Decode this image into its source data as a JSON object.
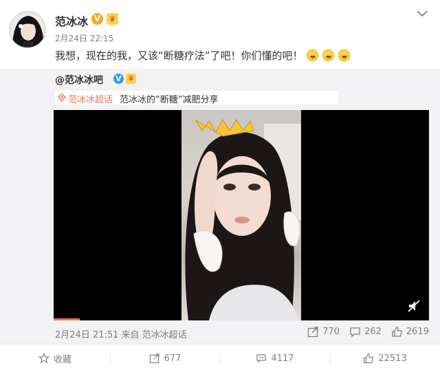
{
  "post": {
    "author": "范冰冰",
    "v_badge": "V",
    "level_badge": "♛",
    "time": "2月24日 22:15",
    "text": "我想，现在的我，又该“断糖疗法”了吧！你们懂的吧！",
    "emojis": [
      "laughing-tears",
      "laughing-tears",
      "laughing-tears"
    ]
  },
  "repost": {
    "author": "@范冰冰吧",
    "v_badge": "V",
    "level_badge": "♛",
    "topic_tag": "范冰冰超话",
    "title": "范冰冰的“断糖”减肥分享",
    "video": {
      "progress_percent": 7,
      "muted": true
    },
    "meta": "2月24日 21:51 来自 范冰冰超话",
    "actions": {
      "reposts": "770",
      "comments": "262",
      "likes": "2619"
    }
  },
  "footer": {
    "favorite": "收藏",
    "repost": "677",
    "comment": "4117",
    "like": "22513"
  },
  "colors": {
    "accent": "#eb7350",
    "muted_text": "#808080",
    "repost_bg": "#f2f2f5",
    "video_bg": "#000000"
  }
}
